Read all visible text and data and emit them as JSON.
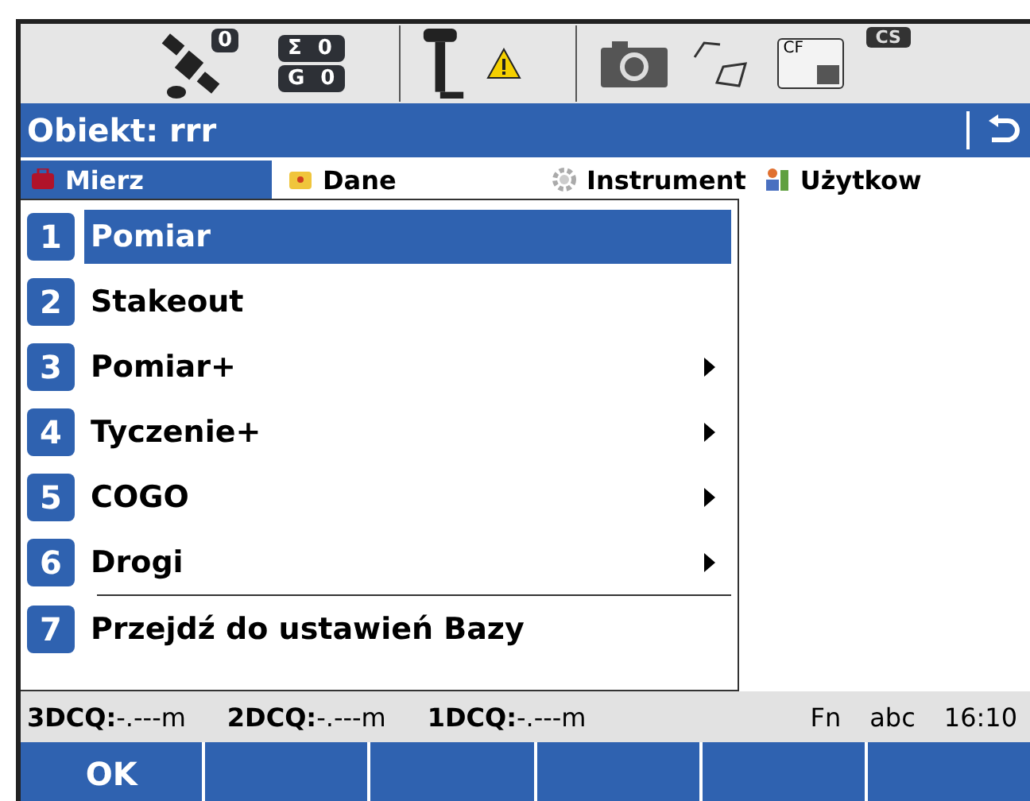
{
  "status_icons": {
    "satellite_count": "0",
    "sigma_label": "Σ",
    "sigma_value": "0",
    "g_label": "G",
    "g_value": "0",
    "card_label": "CF",
    "battery_label": "CS"
  },
  "title_bar": {
    "title": "Obiekt: rrr"
  },
  "tabs": [
    {
      "label": "Mierz",
      "selected": true
    },
    {
      "label": "Dane",
      "selected": false
    },
    {
      "label": "Instrument",
      "selected": false
    },
    {
      "label": "Użytkow",
      "selected": false
    }
  ],
  "menu": [
    {
      "number": "1",
      "label": "Pomiar",
      "selected": true,
      "submenu": false
    },
    {
      "number": "2",
      "label": "Stakeout",
      "selected": false,
      "submenu": false
    },
    {
      "number": "3",
      "label": "Pomiar+",
      "selected": false,
      "submenu": true
    },
    {
      "number": "4",
      "label": "Tyczenie+",
      "selected": false,
      "submenu": true
    },
    {
      "number": "5",
      "label": "COGO",
      "selected": false,
      "submenu": true
    },
    {
      "number": "6",
      "label": "Drogi",
      "selected": false,
      "submenu": true
    },
    {
      "number": "7",
      "label": "Przejdź do ustawień Bazy",
      "selected": false,
      "submenu": false
    }
  ],
  "status_bar": [
    {
      "label": "3DCQ:",
      "value": "-.---m"
    },
    {
      "label": "2DCQ:",
      "value": "-.---m"
    },
    {
      "label": "1DCQ:",
      "value": "-.---m"
    }
  ],
  "status_right": [
    "Fn",
    "abc",
    "16:10"
  ],
  "softkeys": [
    "OK"
  ]
}
